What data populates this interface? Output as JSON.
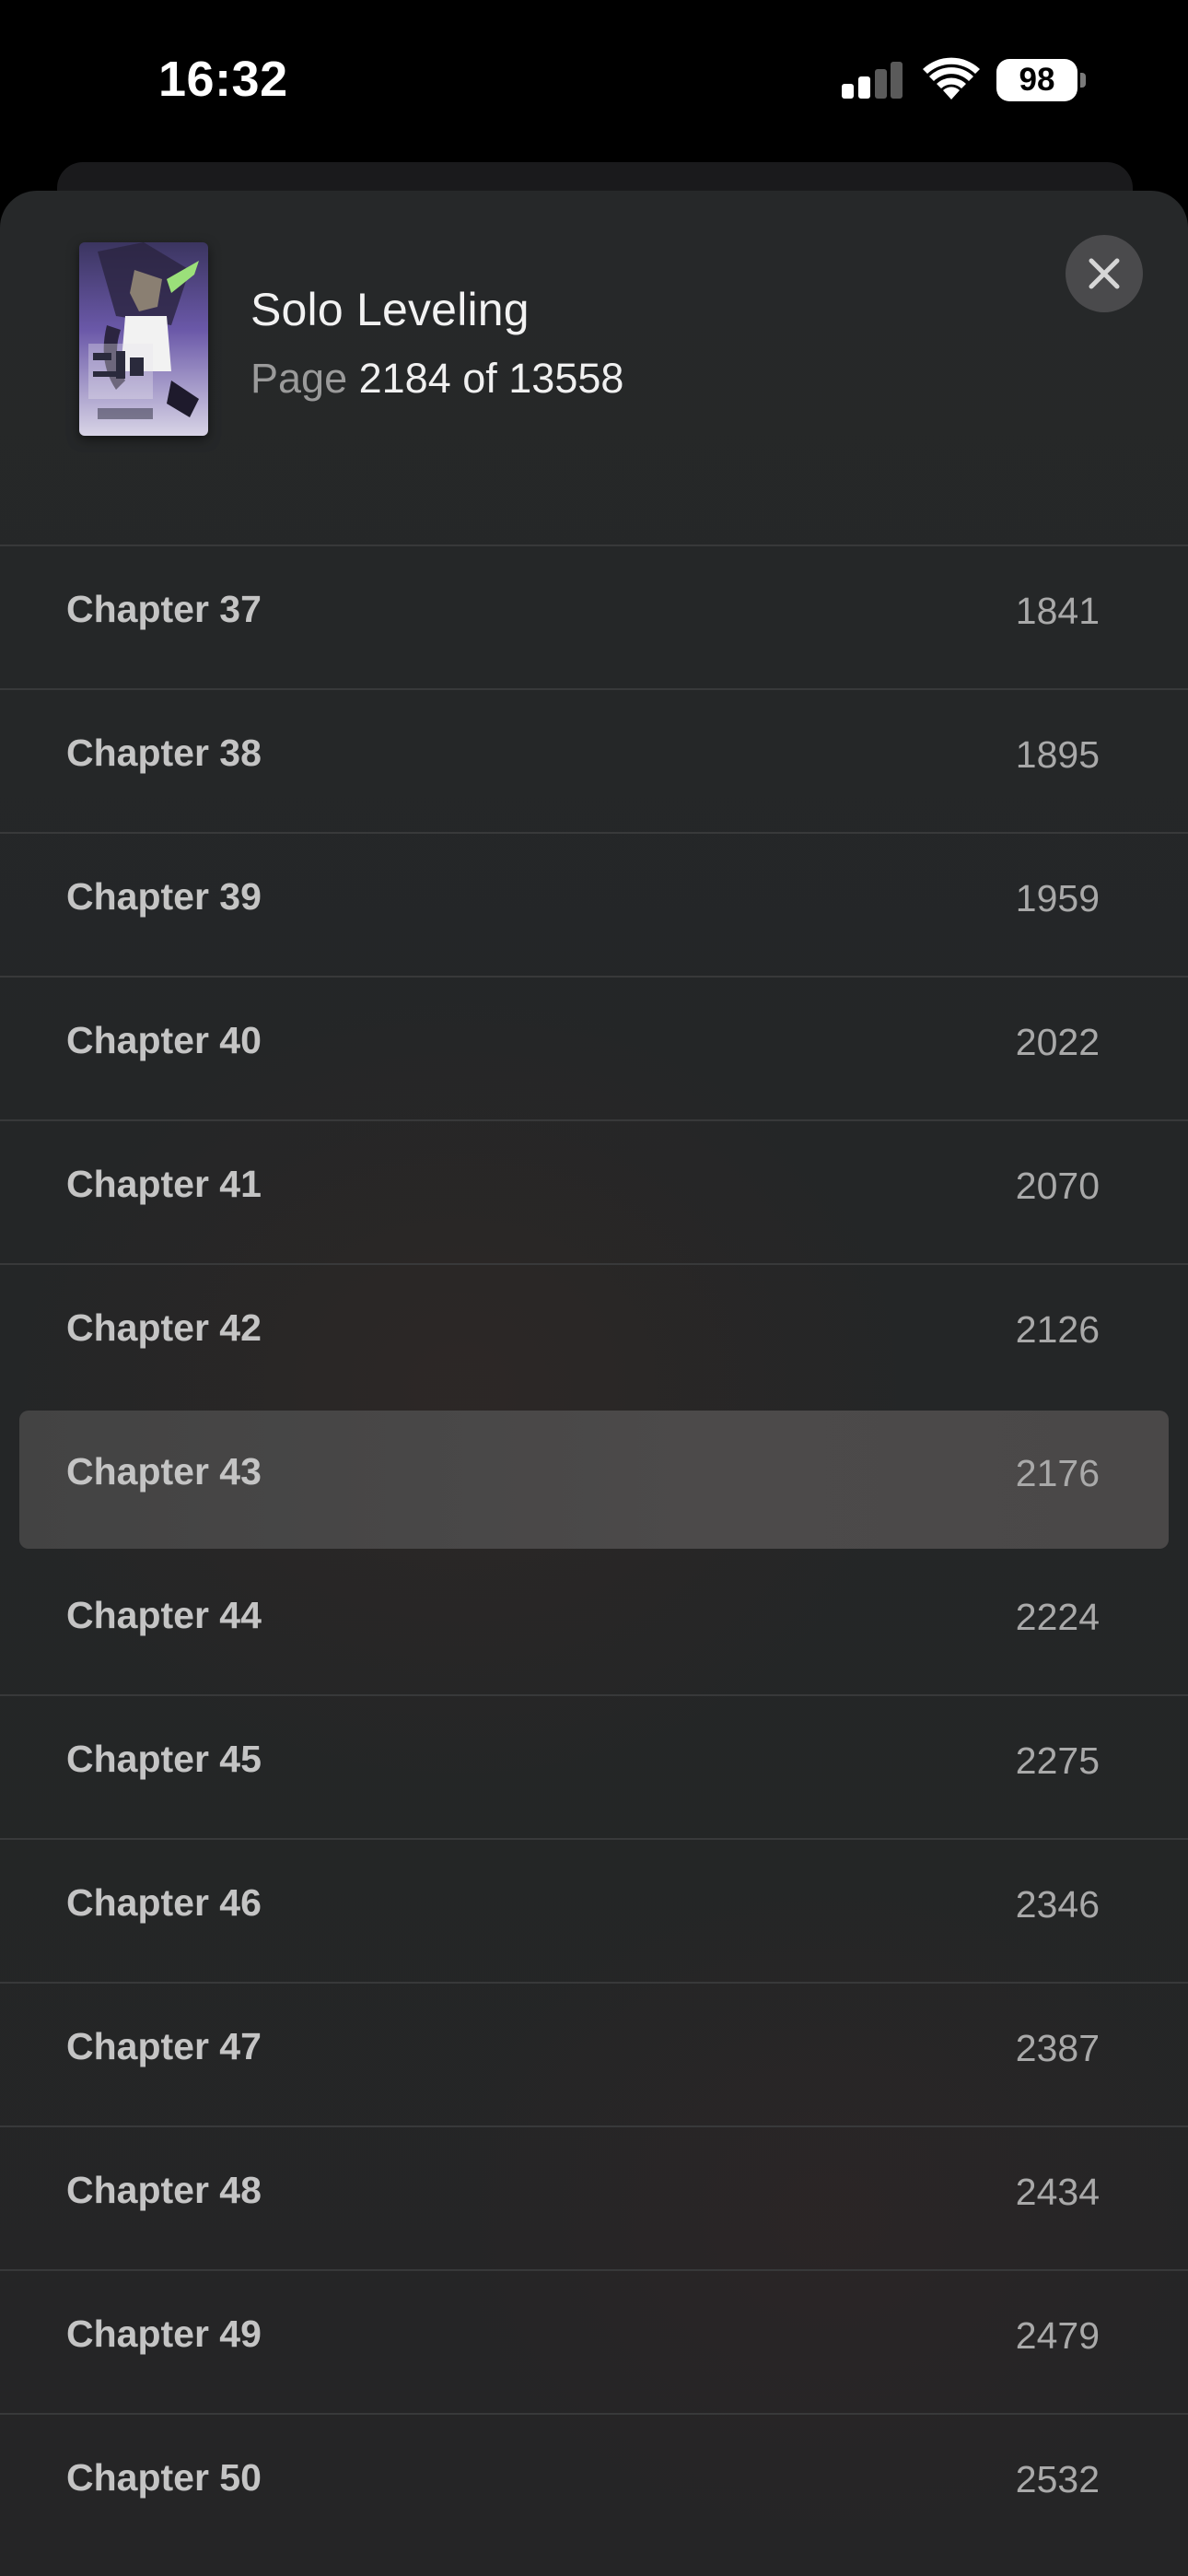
{
  "status_bar": {
    "time": "16:32",
    "battery": "98",
    "icons": [
      "signal-icon",
      "wifi-icon",
      "battery-icon"
    ]
  },
  "book": {
    "title": "Solo Leveling",
    "page_label": "Page",
    "current_page": "2184 of 13558",
    "cover_icon": "book-cover-image"
  },
  "close_icon": "close-icon",
  "current_chapter": "Chapter 43",
  "chapters": [
    {
      "name": "Chapter 37",
      "page": "1841"
    },
    {
      "name": "Chapter 38",
      "page": "1895"
    },
    {
      "name": "Chapter 39",
      "page": "1959"
    },
    {
      "name": "Chapter 40",
      "page": "2022"
    },
    {
      "name": "Chapter 41",
      "page": "2070"
    },
    {
      "name": "Chapter 42",
      "page": "2126"
    },
    {
      "name": "Chapter 43",
      "page": "2176"
    },
    {
      "name": "Chapter 44",
      "page": "2224"
    },
    {
      "name": "Chapter 45",
      "page": "2275"
    },
    {
      "name": "Chapter 46",
      "page": "2346"
    },
    {
      "name": "Chapter 47",
      "page": "2387"
    },
    {
      "name": "Chapter 48",
      "page": "2434"
    },
    {
      "name": "Chapter 49",
      "page": "2479"
    },
    {
      "name": "Chapter 50",
      "page": "2532"
    }
  ]
}
